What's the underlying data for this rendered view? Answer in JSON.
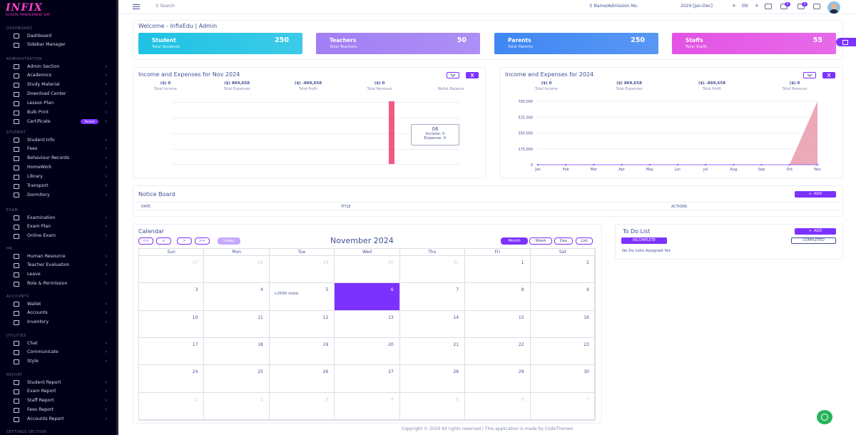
{
  "brand": {
    "logo": "INFIX",
    "tagline": "SCHOOL MANAGEMENT ERP"
  },
  "sidebar": {
    "sections": [
      {
        "label": "DASHBOARD",
        "items": [
          {
            "label": "Dashboard",
            "icon": "dashboard-icon",
            "chev": false
          },
          {
            "label": "Sidebar Manager",
            "icon": "sidebar-manager-icon",
            "chev": false
          }
        ]
      },
      {
        "label": "ADMINISTRATION",
        "items": [
          {
            "label": "Admin Section",
            "icon": "admin-icon",
            "chev": true
          },
          {
            "label": "Academics",
            "icon": "academics-icon",
            "chev": true
          },
          {
            "label": "Study Material",
            "icon": "study-material-icon",
            "chev": true
          },
          {
            "label": "Download Center",
            "icon": "download-icon",
            "chev": true
          },
          {
            "label": "Lesson Plan",
            "icon": "lesson-plan-icon",
            "chev": true
          },
          {
            "label": "Bulk Print",
            "icon": "print-icon",
            "chev": true
          },
          {
            "label": "Certificate",
            "icon": "certificate-icon",
            "chev": true,
            "badge": "Module"
          }
        ]
      },
      {
        "label": "STUDENT",
        "items": [
          {
            "label": "Student Info",
            "icon": "student-icon",
            "chev": true
          },
          {
            "label": "Fees",
            "icon": "fees-icon",
            "chev": true
          },
          {
            "label": "Behaviour Records",
            "icon": "behaviour-icon",
            "chev": true
          },
          {
            "label": "HomeWork",
            "icon": "homework-icon",
            "chev": true
          },
          {
            "label": "Library",
            "icon": "library-icon",
            "chev": true
          },
          {
            "label": "Transport",
            "icon": "transport-icon",
            "chev": true
          },
          {
            "label": "Dormitory",
            "icon": "dormitory-icon",
            "chev": true
          }
        ]
      },
      {
        "label": "EXAM",
        "items": [
          {
            "label": "Examination",
            "icon": "examination-icon",
            "chev": true
          },
          {
            "label": "Exam Plan",
            "icon": "exam-plan-icon",
            "chev": true
          },
          {
            "label": "Online Exam",
            "icon": "online-exam-icon",
            "chev": true
          }
        ]
      },
      {
        "label": "HR",
        "items": [
          {
            "label": "Human Resource",
            "icon": "hr-icon",
            "chev": true
          },
          {
            "label": "Teacher Evaluation",
            "icon": "evaluation-icon",
            "chev": true
          },
          {
            "label": "Leave",
            "icon": "leave-icon",
            "chev": true
          },
          {
            "label": "Role & Permission",
            "icon": "role-icon",
            "chev": true
          }
        ]
      },
      {
        "label": "ACCOUNTS",
        "items": [
          {
            "label": "Wallet",
            "icon": "wallet-icon",
            "chev": true
          },
          {
            "label": "Accounts",
            "icon": "accounts-icon",
            "chev": true
          },
          {
            "label": "Inventory",
            "icon": "inventory-icon",
            "chev": true
          }
        ]
      },
      {
        "label": "UTILITIES",
        "items": [
          {
            "label": "Chat",
            "icon": "chat-icon",
            "chev": true
          },
          {
            "label": "Communicate",
            "icon": "communicate-icon",
            "chev": true
          },
          {
            "label": "Style",
            "icon": "style-icon",
            "chev": true
          }
        ]
      },
      {
        "label": "REPORT",
        "items": [
          {
            "label": "Student Report",
            "icon": "report-icon",
            "chev": true
          },
          {
            "label": "Exam Report",
            "icon": "report-icon",
            "chev": true
          },
          {
            "label": "Staff Report",
            "icon": "report-icon",
            "chev": true
          },
          {
            "label": "Fees Report",
            "icon": "report-icon",
            "chev": true
          },
          {
            "label": "Accounts Report",
            "icon": "report-icon",
            "chev": true
          }
        ]
      },
      {
        "label": "SETTINGS SECTION",
        "items": []
      }
    ]
  },
  "topbar": {
    "search_placeholder": "Search",
    "student_search": "Name/Admission No.",
    "academic_year": "2024 [Jan-Dec]",
    "plus": "+",
    "language": "EN",
    "notifications": [
      "0",
      "0"
    ]
  },
  "welcome": "Welcome - InfixEdu | Admin",
  "stats": [
    {
      "title": "Student",
      "sub": "Total Students",
      "value": "250",
      "color": "#1ec2e4"
    },
    {
      "title": "Teachers",
      "sub": "Total Teachers",
      "value": "50",
      "color": "#a17ef4"
    },
    {
      "title": "Parents",
      "sub": "Total Parents",
      "value": "250",
      "color": "#3f87f3"
    },
    {
      "title": "Staffs",
      "sub": "Total Staffs",
      "value": "55",
      "color": "#e353e5"
    }
  ],
  "month_chart": {
    "title": "Income and Expenses for Nov 2024",
    "summary": [
      {
        "value": "($) 0",
        "label": "Total Income"
      },
      {
        "value": "($) 869,658",
        "label": "Total Expenses"
      },
      {
        "value": "($) -869,658",
        "label": "Total Profit"
      },
      {
        "value": "($) 0",
        "label": "Total Revenue"
      },
      {
        "value": "",
        "label": "Wallet Balance"
      }
    ],
    "tooltip": {
      "title": "06",
      "income": "Income: 0",
      "expense": "Expense: 0"
    }
  },
  "year_chart": {
    "title": "Income and Expenses for 2024",
    "summary": [
      {
        "value": "($) 0",
        "label": "Total Income"
      },
      {
        "value": "($) 869,658",
        "label": "Total Expenses"
      },
      {
        "value": "($) -869,658",
        "label": "Total Profit"
      },
      {
        "value": "($) 0",
        "label": "Total Revenue"
      },
      {
        "value": "",
        "label": "Wallet Balance"
      }
    ]
  },
  "chart_data": [
    {
      "type": "bar",
      "title": "Income and Expenses for Nov 2024",
      "x": [
        "06"
      ],
      "series": [
        {
          "name": "Income",
          "values": [
            0
          ]
        },
        {
          "name": "Expense",
          "values": [
            869658
          ]
        }
      ],
      "grid": true,
      "color": "#f25a86"
    },
    {
      "type": "area",
      "title": "Income and Expenses for 2024",
      "categories": [
        "Jan",
        "Feb",
        "Mar",
        "Apr",
        "May",
        "Jun",
        "Jul",
        "Aug",
        "Sep",
        "Oct",
        "Nov"
      ],
      "y_ticks": [
        "700,000",
        "525,000",
        "350,000",
        "175,000",
        "0"
      ],
      "ylim": [
        0,
        700000
      ],
      "series": [
        {
          "name": "Income",
          "values": [
            0,
            0,
            0,
            0,
            0,
            0,
            0,
            0,
            0,
            0,
            0
          ]
        },
        {
          "name": "Expense",
          "values": [
            0,
            0,
            0,
            0,
            0,
            0,
            0,
            0,
            0,
            0,
            700000
          ]
        }
      ],
      "grid": true,
      "color": "#e99aaa"
    }
  ],
  "notice_board": {
    "title": "Notice Board",
    "add_label": "ADD",
    "columns": [
      "DATE",
      "TITLE",
      "ACTIONS"
    ]
  },
  "calendar": {
    "title": "Calendar",
    "nav": [
      "<<",
      "<",
      ">",
      ">>"
    ],
    "today_label": "today",
    "month_title": "November 2024",
    "views": [
      "Month",
      "Week",
      "Day",
      "List"
    ],
    "days": [
      "Sun",
      "Mon",
      "Tue",
      "Wed",
      "Thu",
      "Fri",
      "Sat"
    ],
    "weeks": [
      [
        "27",
        "28",
        "29",
        "30",
        "31",
        "1",
        "2"
      ],
      [
        "3",
        "4",
        "5",
        "6",
        "7",
        "8",
        "9"
      ],
      [
        "10",
        "11",
        "12",
        "13",
        "14",
        "15",
        "16"
      ],
      [
        "17",
        "18",
        "19",
        "20",
        "21",
        "22",
        "23"
      ],
      [
        "24",
        "25",
        "26",
        "27",
        "28",
        "29",
        "30"
      ],
      [
        "1",
        "2",
        "3",
        "4",
        "5",
        "6",
        "7"
      ]
    ],
    "more_text": "+2500 more"
  },
  "todo": {
    "title": "To Do List",
    "add_label": "ADD",
    "incomplete": "INCOMPLETE",
    "completed": "COMPLETED",
    "empty": "No Do Lists Assigned Yet"
  },
  "footer": "Copyright © 2020 All rights reserved | This application is made by CodeThemes"
}
